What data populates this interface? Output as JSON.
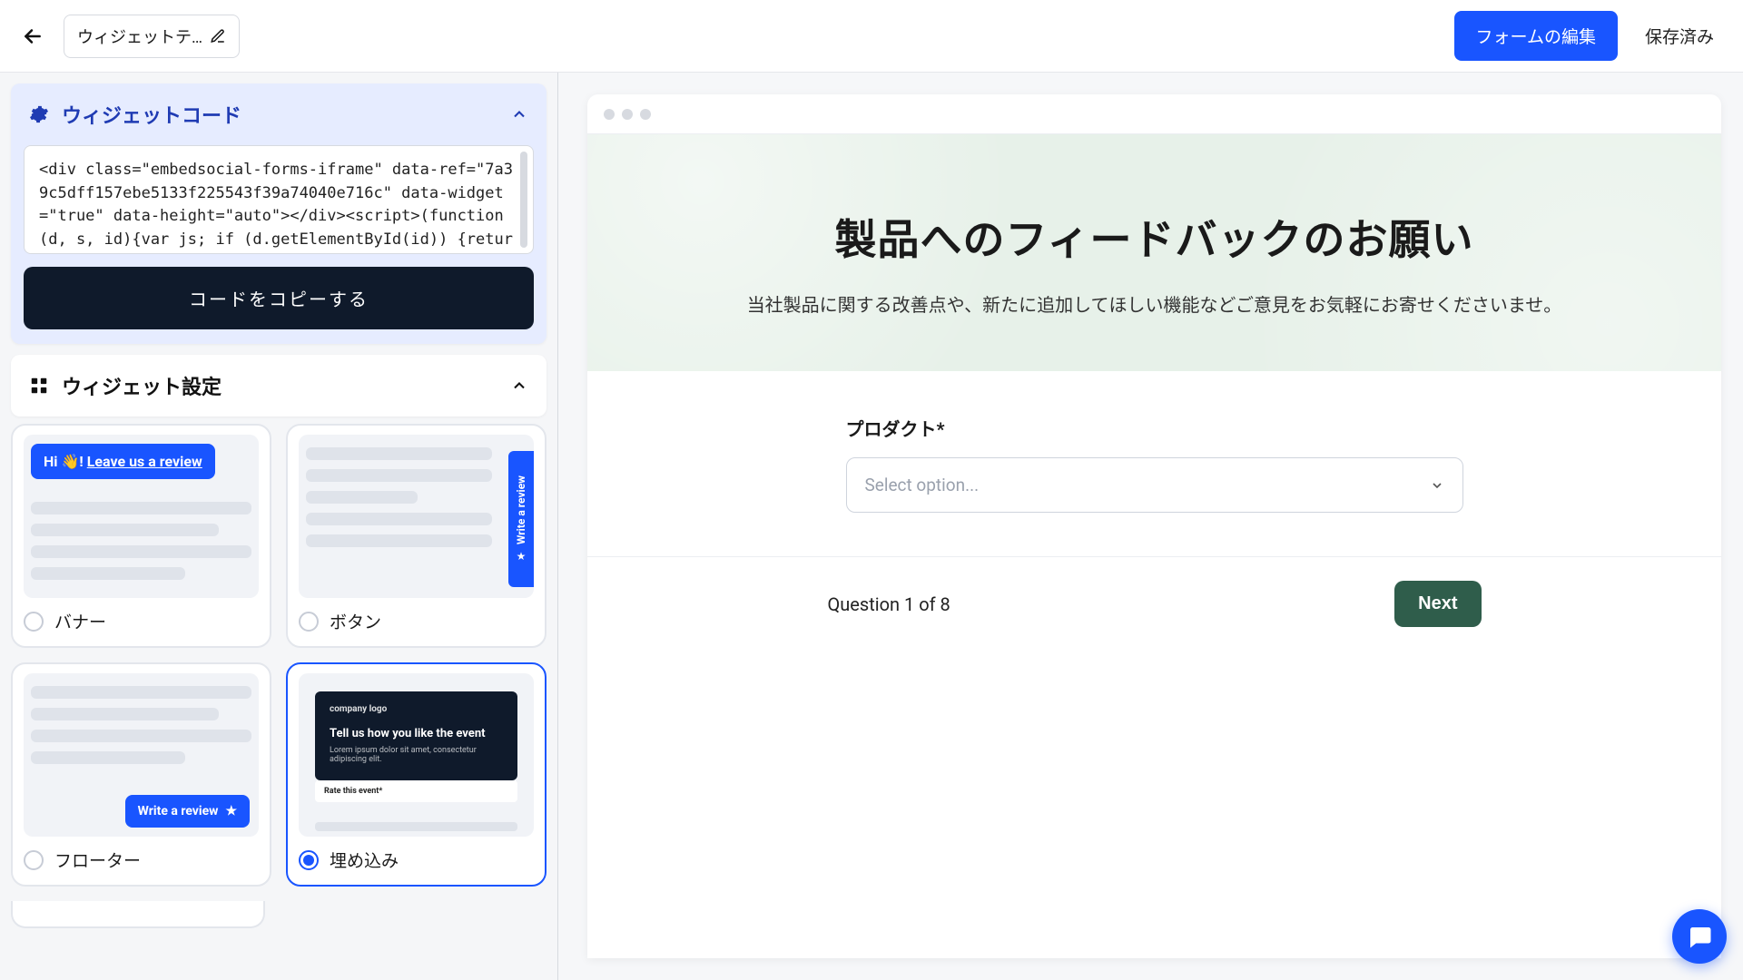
{
  "topbar": {
    "title_truncated": "ウィジェットテ…",
    "edit_form_btn": "フォームの編集",
    "saved_label": "保存済み"
  },
  "sidebar": {
    "code_section": {
      "title": "ウィジェットコード",
      "snippet": "<div class=\"embedsocial-forms-iframe\" data-ref=\"7a39c5dff157ebe5133f225543f39a74040e716c\" data-widget=\"true\" data-height=\"auto\"></div><script>(function(d, s, id){var js; if (d.getElementById(id)) {return;} js = d.createElement(s); js.id = id; js.src = \"https://embedsoci",
      "copy_btn": "コードをコピーする"
    },
    "settings_section": {
      "title": "ウィジェット設定"
    },
    "widgets": {
      "banner": {
        "label": "バナー",
        "badge_prefix": "Hi 👋! ",
        "badge_link": "Leave us a review"
      },
      "button": {
        "label": "ボタン",
        "side_text": "Write a review"
      },
      "floater": {
        "label": "フローター",
        "btn_text": "Write a review"
      },
      "embed": {
        "label": "埋め込み",
        "logo": "company logo",
        "heading": "Tell us how you like the event",
        "sub": "Lorem ipsum dolor sit amet, consectetur adipiscing elit.",
        "rate": "Rate this event*",
        "selected": true
      }
    }
  },
  "preview": {
    "hero_title": "製品へのフィードバックのお願い",
    "hero_desc": "当社製品に関する改善点や、新たに追加してほしい機能などご意見をお気軽にお寄せくださいませ。",
    "field_label": "プロダクト*",
    "select_placeholder": "Select option...",
    "question_counter": "Question 1 of 8",
    "next_btn": "Next"
  }
}
